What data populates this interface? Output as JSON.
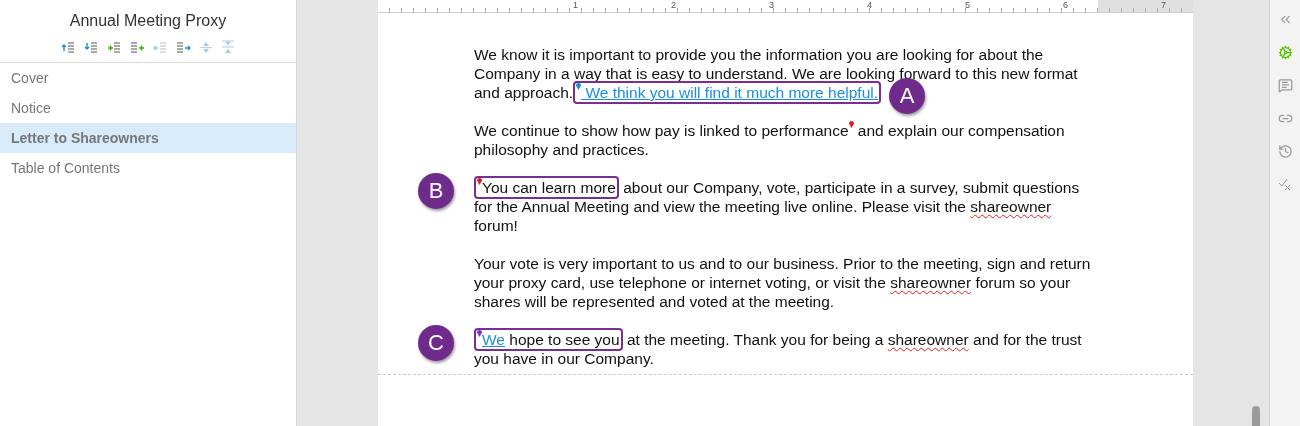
{
  "sidebar": {
    "title": "Annual Meeting Proxy",
    "tools": [
      {
        "kind": "up-add"
      },
      {
        "kind": "down-add"
      },
      {
        "kind": "plus-left"
      },
      {
        "kind": "plus-right"
      },
      {
        "kind": "outdent"
      },
      {
        "kind": "indent"
      },
      {
        "kind": "expand"
      },
      {
        "kind": "collapse"
      }
    ],
    "items": [
      {
        "label": "Cover",
        "selected": false
      },
      {
        "label": "Notice",
        "selected": false
      },
      {
        "label": "Letter to Shareowners",
        "selected": true
      },
      {
        "label": "Table of Contents",
        "selected": false
      }
    ]
  },
  "ruler": [
    "1",
    "2",
    "3",
    "4",
    "5",
    "6",
    "7"
  ],
  "paragraphs": [
    [
      [
        {
          "kind": "text",
          "text": "We know it is important to provide you the information you are looking for about the"
        }
      ],
      [
        {
          "kind": "text",
          "text": "Company in a way that is easy to understand. We are looking forward to this new format"
        }
      ],
      [
        {
          "kind": "text",
          "text": "and approach."
        },
        {
          "kind": "callout",
          "label": "A",
          "badge_left": false,
          "pin": {
            "color": "#1a8fe0"
          },
          "children": [
            {
              "kind": "link",
              "text": " We think you will find it much more helpful."
            }
          ]
        }
      ]
    ],
    [
      [
        {
          "kind": "text",
          "text": "We continue to show how pay is linked to performance"
        },
        {
          "kind": "pin",
          "color": "#e02020"
        },
        {
          "kind": "text",
          "text": " and explain our compensation"
        }
      ],
      [
        {
          "kind": "text",
          "text": "philosophy and practices."
        }
      ]
    ],
    [
      [
        {
          "kind": "callout",
          "label": "B",
          "badge_left": true,
          "pin": {
            "color": "#e02020"
          },
          "children": [
            {
              "kind": "text",
              "text": "You can learn more"
            }
          ]
        },
        {
          "kind": "text",
          "text": " about our Company, vote, participate in a survey, submit questions"
        }
      ],
      [
        {
          "kind": "text",
          "text": "for the Annual Meeting and view the meeting live online. Please visit the "
        },
        {
          "kind": "misspelled",
          "text": "shareowner"
        }
      ],
      [
        {
          "kind": "text",
          "text": "forum!"
        }
      ]
    ],
    [
      [
        {
          "kind": "text",
          "text": "Your vote is very important to us and to our business. Prior to the meeting, sign and return"
        }
      ],
      [
        {
          "kind": "text",
          "text": "your proxy card, use telephone or internet voting, or visit the "
        },
        {
          "kind": "misspelled",
          "text": "shareowner"
        },
        {
          "kind": "text",
          "text": " forum so your"
        }
      ],
      [
        {
          "kind": "text",
          "text": "shares will be represented and voted at the meeting."
        }
      ]
    ],
    [
      [
        {
          "kind": "callout",
          "label": "C",
          "badge_left": true,
          "pin": {
            "color": "#8a2be2"
          },
          "children": [
            {
              "kind": "link",
              "text": "We"
            },
            {
              "kind": "text",
              "text": " hope to see you"
            }
          ]
        },
        {
          "kind": "text",
          "text": " at the meeting. Thank you for being a "
        },
        {
          "kind": "misspelled",
          "text": "shareowner"
        },
        {
          "kind": "text",
          "text": " and for the trust"
        }
      ],
      [
        {
          "kind": "text",
          "text": "you have in our Company."
        }
      ]
    ]
  ],
  "rail": [
    {
      "kind": "collapse",
      "active": false
    },
    {
      "kind": "settings",
      "active": true
    },
    {
      "kind": "comments",
      "active": false
    },
    {
      "kind": "link",
      "active": false
    },
    {
      "kind": "history",
      "active": false
    },
    {
      "kind": "review",
      "active": false
    }
  ]
}
